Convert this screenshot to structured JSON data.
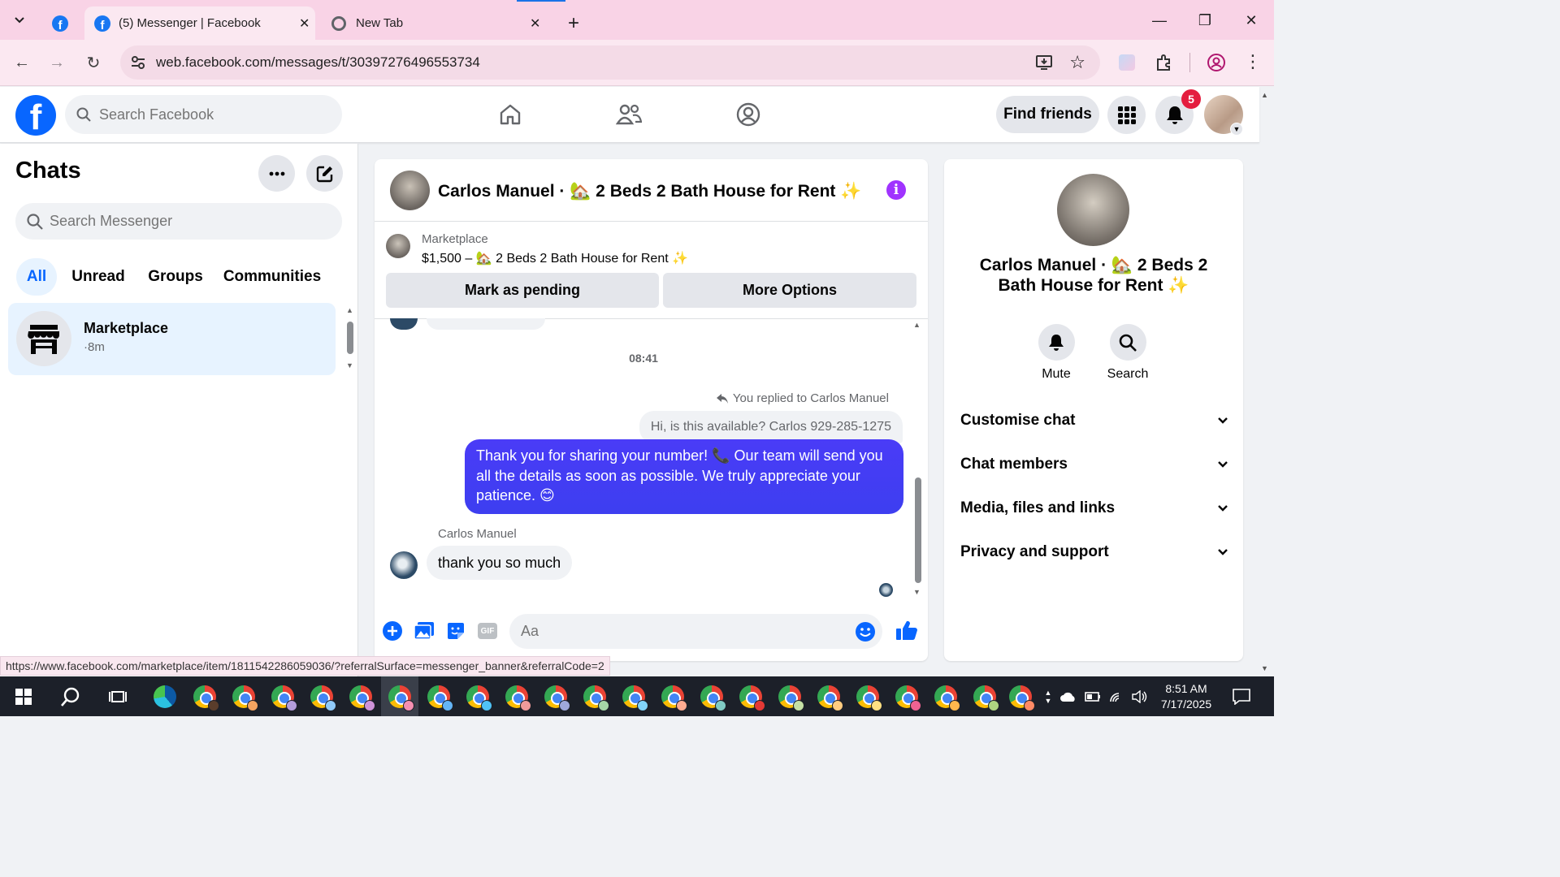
{
  "browser": {
    "tabs": [
      {
        "title": "(5) Messenger | Facebook",
        "active": true
      },
      {
        "title": "New Tab",
        "active": false
      }
    ],
    "url": "web.facebook.com/messages/t/30397276496553734",
    "status_url": "https://www.facebook.com/marketplace/item/1811542286059036/?referralSurface=messenger_banner&referralCode=2"
  },
  "fb_header": {
    "search_placeholder": "Search Facebook",
    "find_friends": "Find friends",
    "notification_count": "5"
  },
  "sidebar": {
    "title": "Chats",
    "search_placeholder": "Search Messenger",
    "filters": [
      "All",
      "Unread",
      "Groups",
      "Communities"
    ],
    "active_filter": "All",
    "chats": [
      {
        "name": "Marketplace",
        "time": "·8m"
      }
    ]
  },
  "conversation": {
    "title": "Carlos Manuel · 🏡 2 Beds 2 Bath House for Rent ✨",
    "marketplace": {
      "label": "Marketplace",
      "listing": "$1,500 – 🏡 2 Beds 2 Bath House for Rent ✨",
      "mark_pending": "Mark as pending",
      "more_options": "More Options"
    },
    "timestamp": "08:41",
    "reply_note": "You replied to Carlos Manuel",
    "quoted_message": "Hi, is this available? Carlos 929-285-1275",
    "sent_message": "Thank you for sharing your number! 📞 Our team will send you all the details as soon as possible. We truly appreciate your patience. 😊",
    "sender_name": "Carlos Manuel",
    "received_message": "thank you so much",
    "input_placeholder": "Aa"
  },
  "info_panel": {
    "name": "Carlos Manuel · 🏡 2 Beds 2 Bath House for Rent ✨",
    "actions": [
      "Mute",
      "Search"
    ],
    "sections": [
      "Customise chat",
      "Chat members",
      "Media, files and links",
      "Privacy and support"
    ]
  },
  "taskbar": {
    "time": "8:51 AM",
    "date": "7/17/2025"
  },
  "colors": {
    "fb_blue": "#0866ff",
    "sent_bubble": "#3d3ef0",
    "info_purple": "#a033ff",
    "badge_red": "#e41e3f"
  }
}
